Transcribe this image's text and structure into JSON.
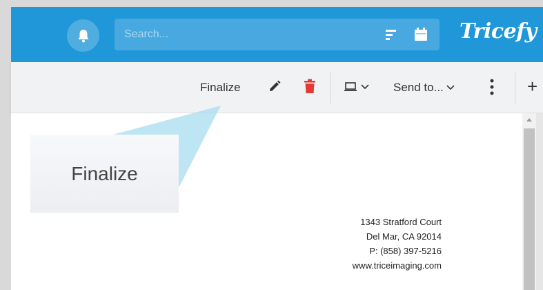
{
  "header": {
    "search_placeholder": "Search...",
    "logo": "Tricefy",
    "accent_color": "#1f97d8",
    "icons": [
      "bell-icon",
      "filter-icon",
      "calendar-icon"
    ]
  },
  "toolbar": {
    "finalize_label": "Finalize",
    "send_to_label": "Send to...",
    "plus_label": "+",
    "icons": [
      "pencil-icon",
      "trash-icon",
      "monitor-icon",
      "chevron-down-icon",
      "more-vertical-icon"
    ],
    "trash_color": "#e53935"
  },
  "document": {
    "address_lines": [
      "1343 Stratford Court",
      "Del Mar, CA 92014",
      "P: (858) 397-5216",
      "www.triceimaging.com"
    ]
  },
  "callout": {
    "label": "Finalize"
  }
}
